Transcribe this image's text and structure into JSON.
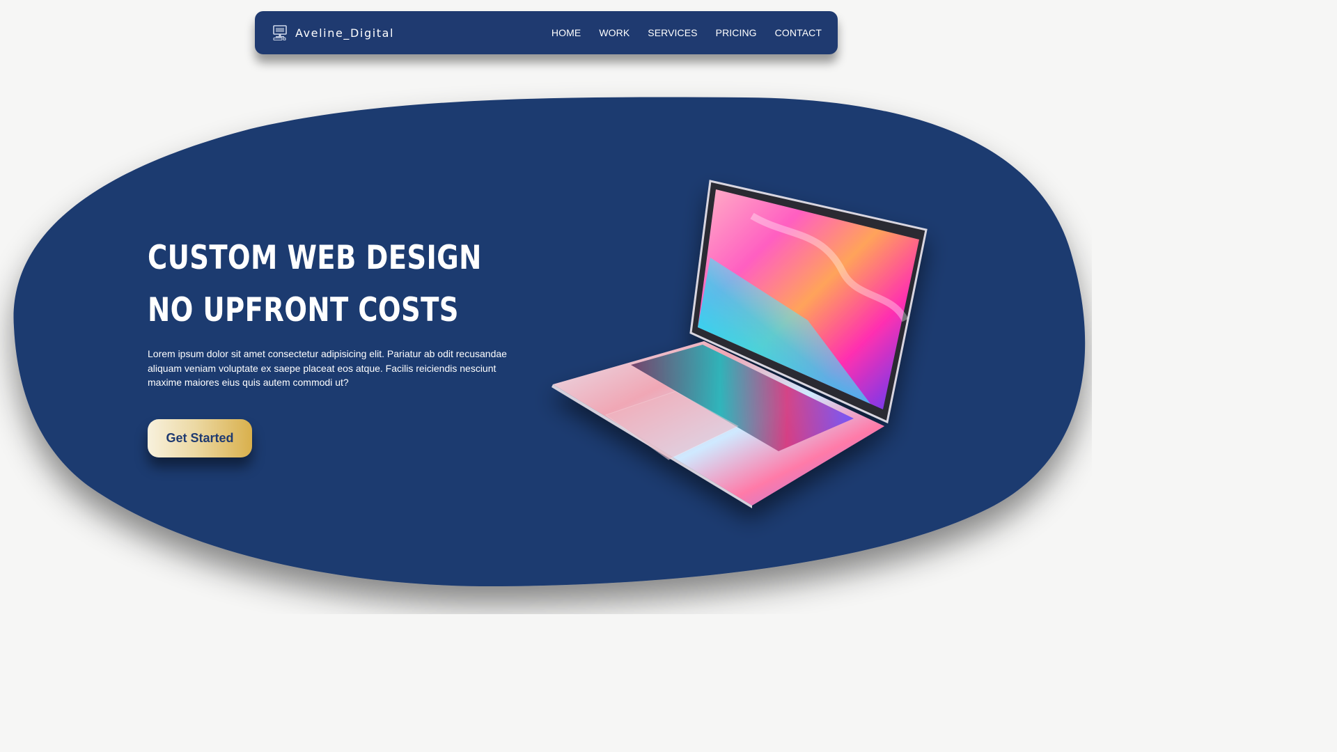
{
  "nav": {
    "brand_name": "Aveline_Digital",
    "brand_icon": "desktop-computer-icon",
    "links": [
      {
        "label": "HOME"
      },
      {
        "label": "WORK"
      },
      {
        "label": "SERVICES"
      },
      {
        "label": "PRICING"
      },
      {
        "label": "CONTACT"
      }
    ]
  },
  "hero": {
    "title_line1": "CUSTOM WEB DESIGN",
    "title_line2": "NO UPFRONT COSTS",
    "body": "Lorem ipsum dolor sit amet consectetur adipisicing elit. Pariatur ab odit recusandae aliquam veniam voluptate ex saepe placeat eos atque. Facilis reiciendis nesciunt maxime maiores eius quis autem commodi ut?",
    "cta_label": "Get Started",
    "image": "laptop-illustration"
  },
  "colors": {
    "background": "#f6f6f5",
    "primary_navy": "#1f3a70",
    "text_light": "#ffffff",
    "cta_gradient_start": "#f8f1dd",
    "cta_gradient_end": "#d9b04c"
  }
}
